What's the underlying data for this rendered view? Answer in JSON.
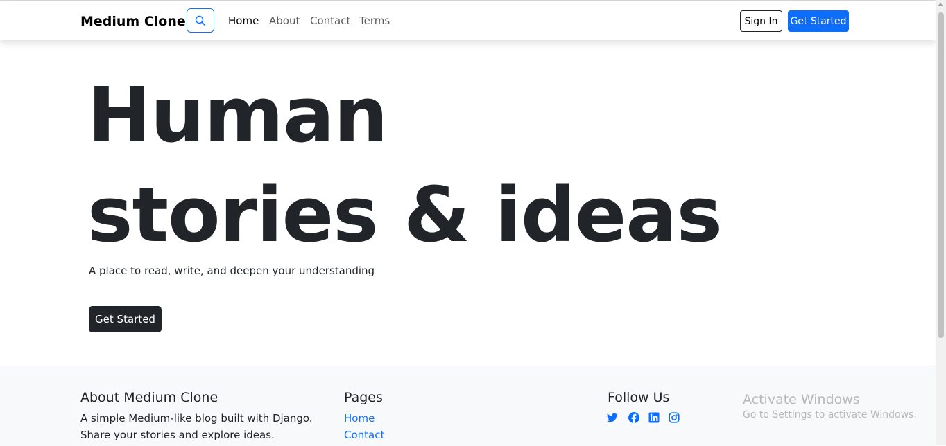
{
  "navbar": {
    "brand": "Medium Clone",
    "search_icon": "search-icon",
    "links": [
      "Home",
      "About",
      "Contact",
      "Terms"
    ],
    "active_link": "Home",
    "sign_in": "Sign In",
    "get_started": "Get Started",
    "accent_color": "#0d6efd"
  },
  "hero": {
    "title_line1": "Human",
    "title_line2": "stories & ideas",
    "subtitle": "A place to read, write, and deepen your understanding",
    "cta": "Get Started"
  },
  "footer": {
    "about": {
      "title": "About Medium Clone",
      "line1": "A simple Medium-like blog built with Django.",
      "line2": "Share your stories and explore ideas."
    },
    "pages": {
      "title": "Pages",
      "links": [
        "Home",
        "Contact"
      ]
    },
    "follow": {
      "title": "Follow Us",
      "icons": [
        "twitter-icon",
        "facebook-icon",
        "linkedin-icon",
        "instagram-icon"
      ]
    }
  },
  "windows_watermark": {
    "title": "Activate Windows",
    "subtitle": "Go to Settings to activate Windows."
  }
}
